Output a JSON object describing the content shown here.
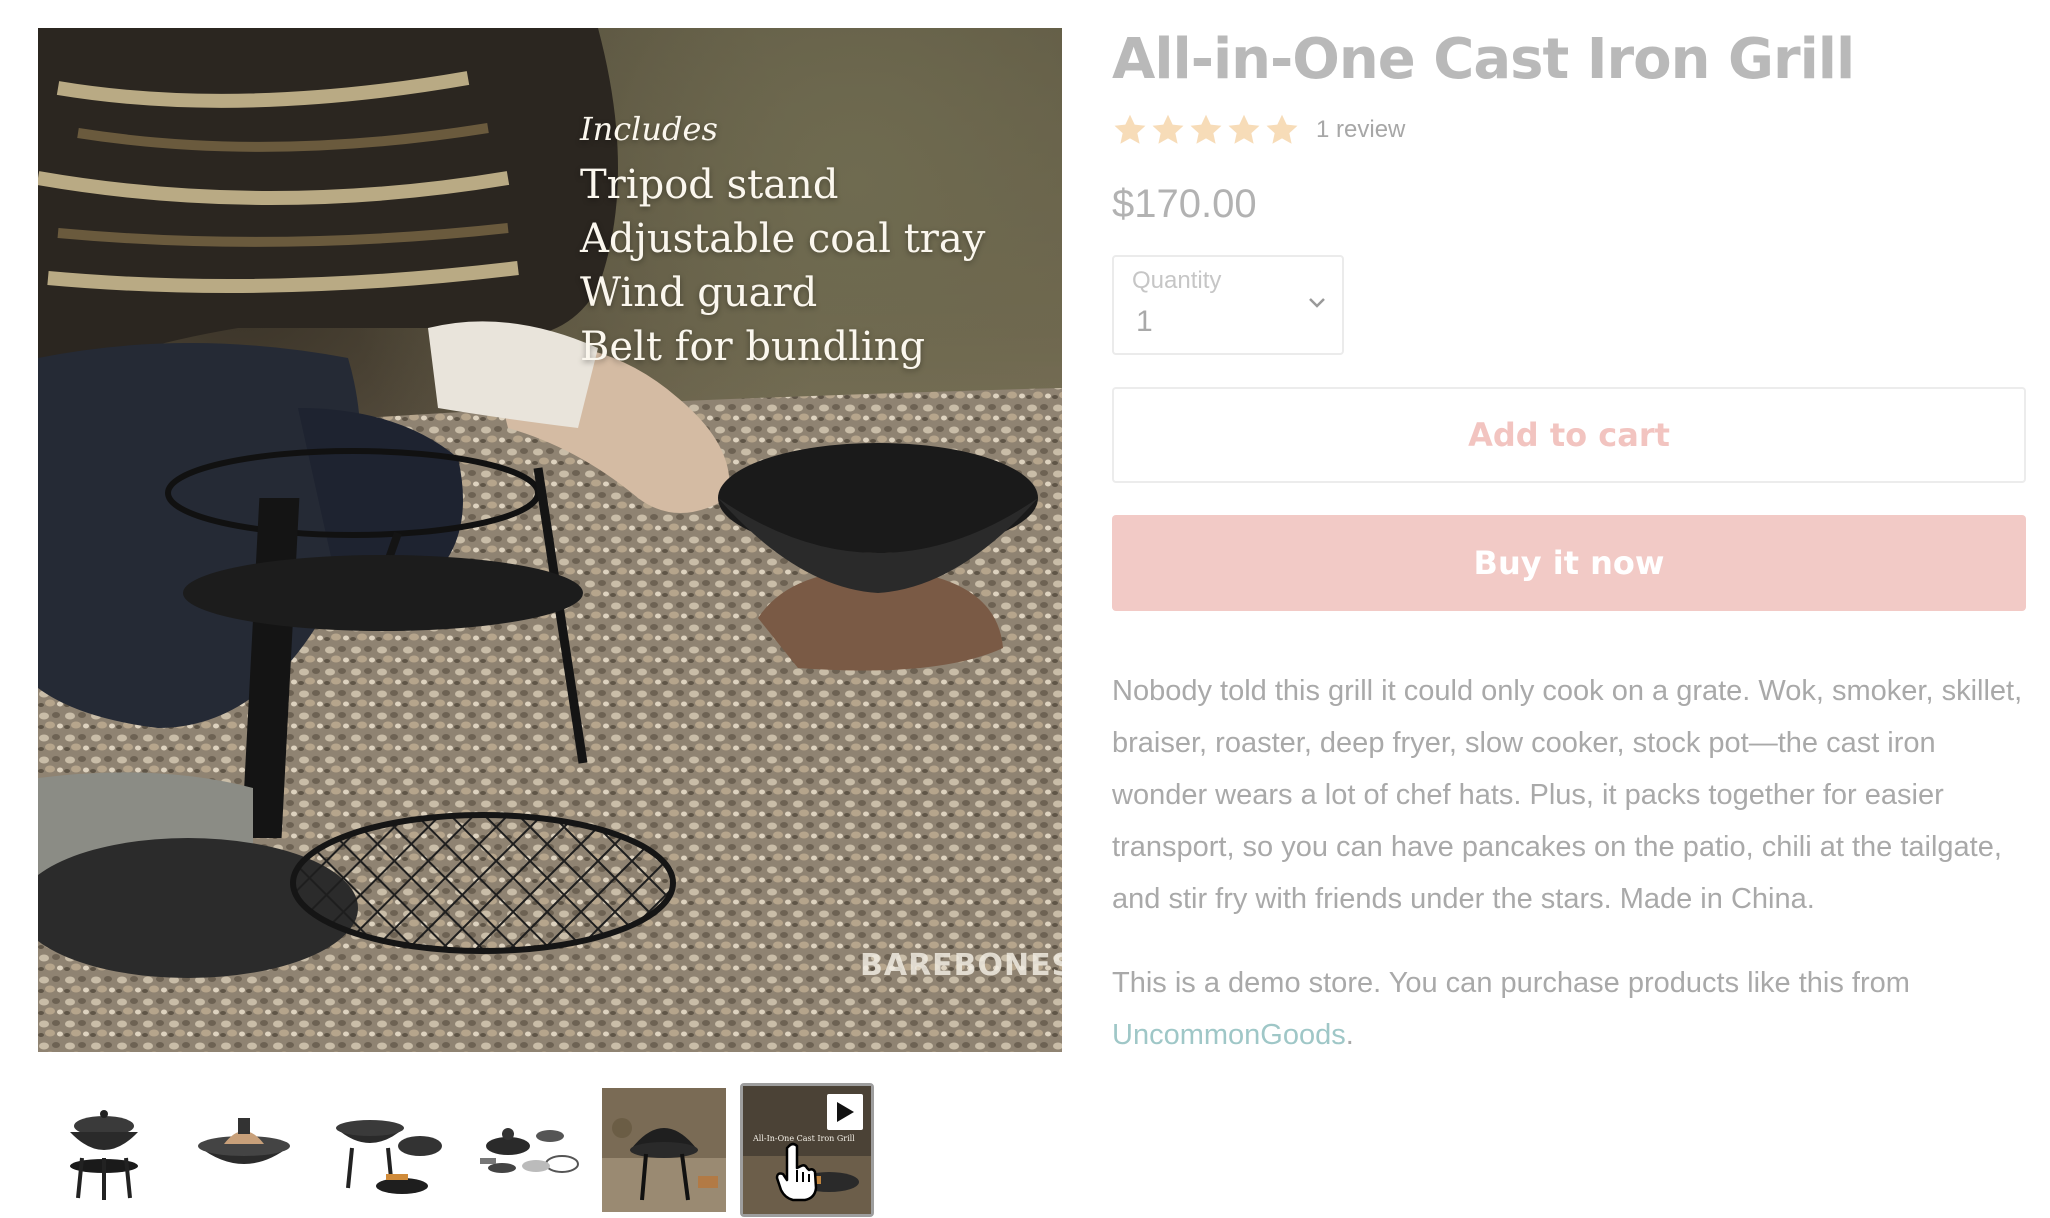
{
  "product": {
    "title": "All-in-One Cast Iron Grill",
    "rating_value": 5,
    "rating_max": 5,
    "review_count_label": "1 review",
    "price": "$170.00",
    "quantity_label": "Quantity",
    "quantity_value": "1",
    "add_to_cart_label": "Add to cart",
    "buy_now_label": "Buy it now",
    "description": "Nobody told this grill it could only cook on a grate. Wok, smoker, skillet, braiser, roaster, deep fryer, slow cooker, stock pot—the cast iron wonder wears a lot of chef hats. Plus, it packs together for easier transport, so you can have pancakes on the patio, chili at the tailgate, and stir fry with friends under the stars. Made in China.",
    "demo_note_prefix": "This is a demo store. You can purchase products like this from ",
    "demo_link_label": "UncommonGoods",
    "demo_note_suffix": "."
  },
  "media": {
    "overlay_heading": "Includes",
    "overlay_items": [
      "Tripod stand",
      "Adjustable coal tray",
      "Wind guard",
      "Belt for bundling"
    ],
    "brand_mark": "BAREBONES",
    "thumbnails": [
      {
        "name": "grill-assembled",
        "selected": false
      },
      {
        "name": "wok-with-lid",
        "selected": false
      },
      {
        "name": "grill-open-lid",
        "selected": false
      },
      {
        "name": "grill-accessories",
        "selected": false
      },
      {
        "name": "grill-outdoor-photo",
        "selected": false
      },
      {
        "name": "product-video",
        "selected": true,
        "caption": "All-In-One Cast Iron Grill"
      }
    ]
  },
  "colors": {
    "star": "#f7dcb8",
    "buy_now_bg": "#f2cac6",
    "add_to_cart_text": "#f2c4c0",
    "link": "#9fc7c7"
  },
  "icons": [
    "star-icon",
    "chevron-down-icon",
    "play-icon",
    "hand-cursor-icon"
  ]
}
